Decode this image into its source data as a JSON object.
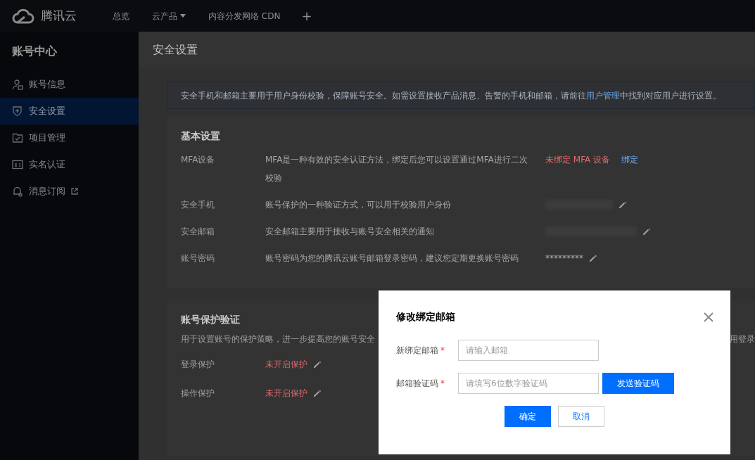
{
  "topbar": {
    "brand": "腾讯云",
    "nav": [
      {
        "label": "总览",
        "dropdown": false
      },
      {
        "label": "云产品",
        "dropdown": true
      },
      {
        "label": "内容分发网络 CDN",
        "dropdown": false
      }
    ],
    "add": "+"
  },
  "sidebar": {
    "title": "账号中心",
    "items": [
      {
        "label": "账号信息",
        "selected": false,
        "external": false
      },
      {
        "label": "安全设置",
        "selected": true,
        "external": false
      },
      {
        "label": "项目管理",
        "selected": false,
        "external": false
      },
      {
        "label": "实名认证",
        "selected": false,
        "external": false
      },
      {
        "label": "消息订阅",
        "selected": false,
        "external": true
      }
    ]
  },
  "page_title": "安全设置",
  "notice": {
    "before": "安全手机和邮箱主要用于用户身份校验，保障账号安全。如需设置接收产品消息、告警的手机和邮箱，请前往",
    "link": "用户管理",
    "after": "中找到对应用户进行设置。"
  },
  "basic": {
    "title": "基本设置",
    "rows": [
      {
        "label": "MFA设备",
        "description": "MFA是一种有效的安全认证方法，绑定后您可以设置通过MFA进行二次校验",
        "kind": "status",
        "value": "未绑定 MFA 设备",
        "action": "绑定"
      },
      {
        "label": "安全手机",
        "description": "账号保护的一种验证方式，可以用于校验用户身份",
        "kind": "blurred"
      },
      {
        "label": "安全邮箱",
        "description": "安全邮箱主要用于接收与账号安全相关的通知",
        "kind": "blurred"
      },
      {
        "label": "账号密码",
        "description": "账号密码为您的腾讯云账号邮箱登录密码，建议您定期更换账号密码",
        "kind": "masked",
        "value": "*********"
      }
    ]
  },
  "protection": {
    "title": "账号保护验证",
    "description": "用于设置账号的保护策略，进一步提高您的账号安全",
    "description_tail": "用登录",
    "rows": [
      {
        "label": "登录保护",
        "value": "未开启保护",
        "enabled": false
      },
      {
        "label": "操作保护",
        "value": "未开启保护",
        "enabled": false
      }
    ]
  },
  "dialog": {
    "title": "修改绑定邮箱",
    "fields": [
      {
        "label": "新绑定邮箱",
        "required_mark": "*",
        "placeholder": "请输入邮箱"
      },
      {
        "label": "邮箱验证码",
        "required_mark": "*",
        "placeholder": "请填写6位数字验证码",
        "button": "发送验证码"
      }
    ],
    "confirm": "确定",
    "cancel": "取消"
  }
}
